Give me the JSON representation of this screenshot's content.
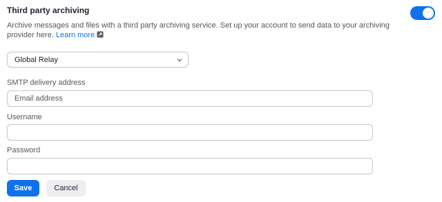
{
  "section": {
    "title": "Third party archiving",
    "description": "Archive messages and files with a third party archiving service. Set up your account to send data to your archiving provider here.",
    "learn_more": "Learn more",
    "toggle_on": true
  },
  "provider": {
    "selected": "Global Relay"
  },
  "smtp": {
    "label": "SMTP delivery address",
    "placeholder": "Email address",
    "value": ""
  },
  "username": {
    "label": "Username",
    "value": ""
  },
  "password": {
    "label": "Password",
    "value": ""
  },
  "buttons": {
    "save": "Save",
    "cancel": "Cancel"
  },
  "colors": {
    "accent": "#0e72ed",
    "cancel_bg": "#eeeef2",
    "text": "#232333"
  },
  "icons": {
    "learn_more": "external-link-icon",
    "select": "chevron-down-icon"
  }
}
